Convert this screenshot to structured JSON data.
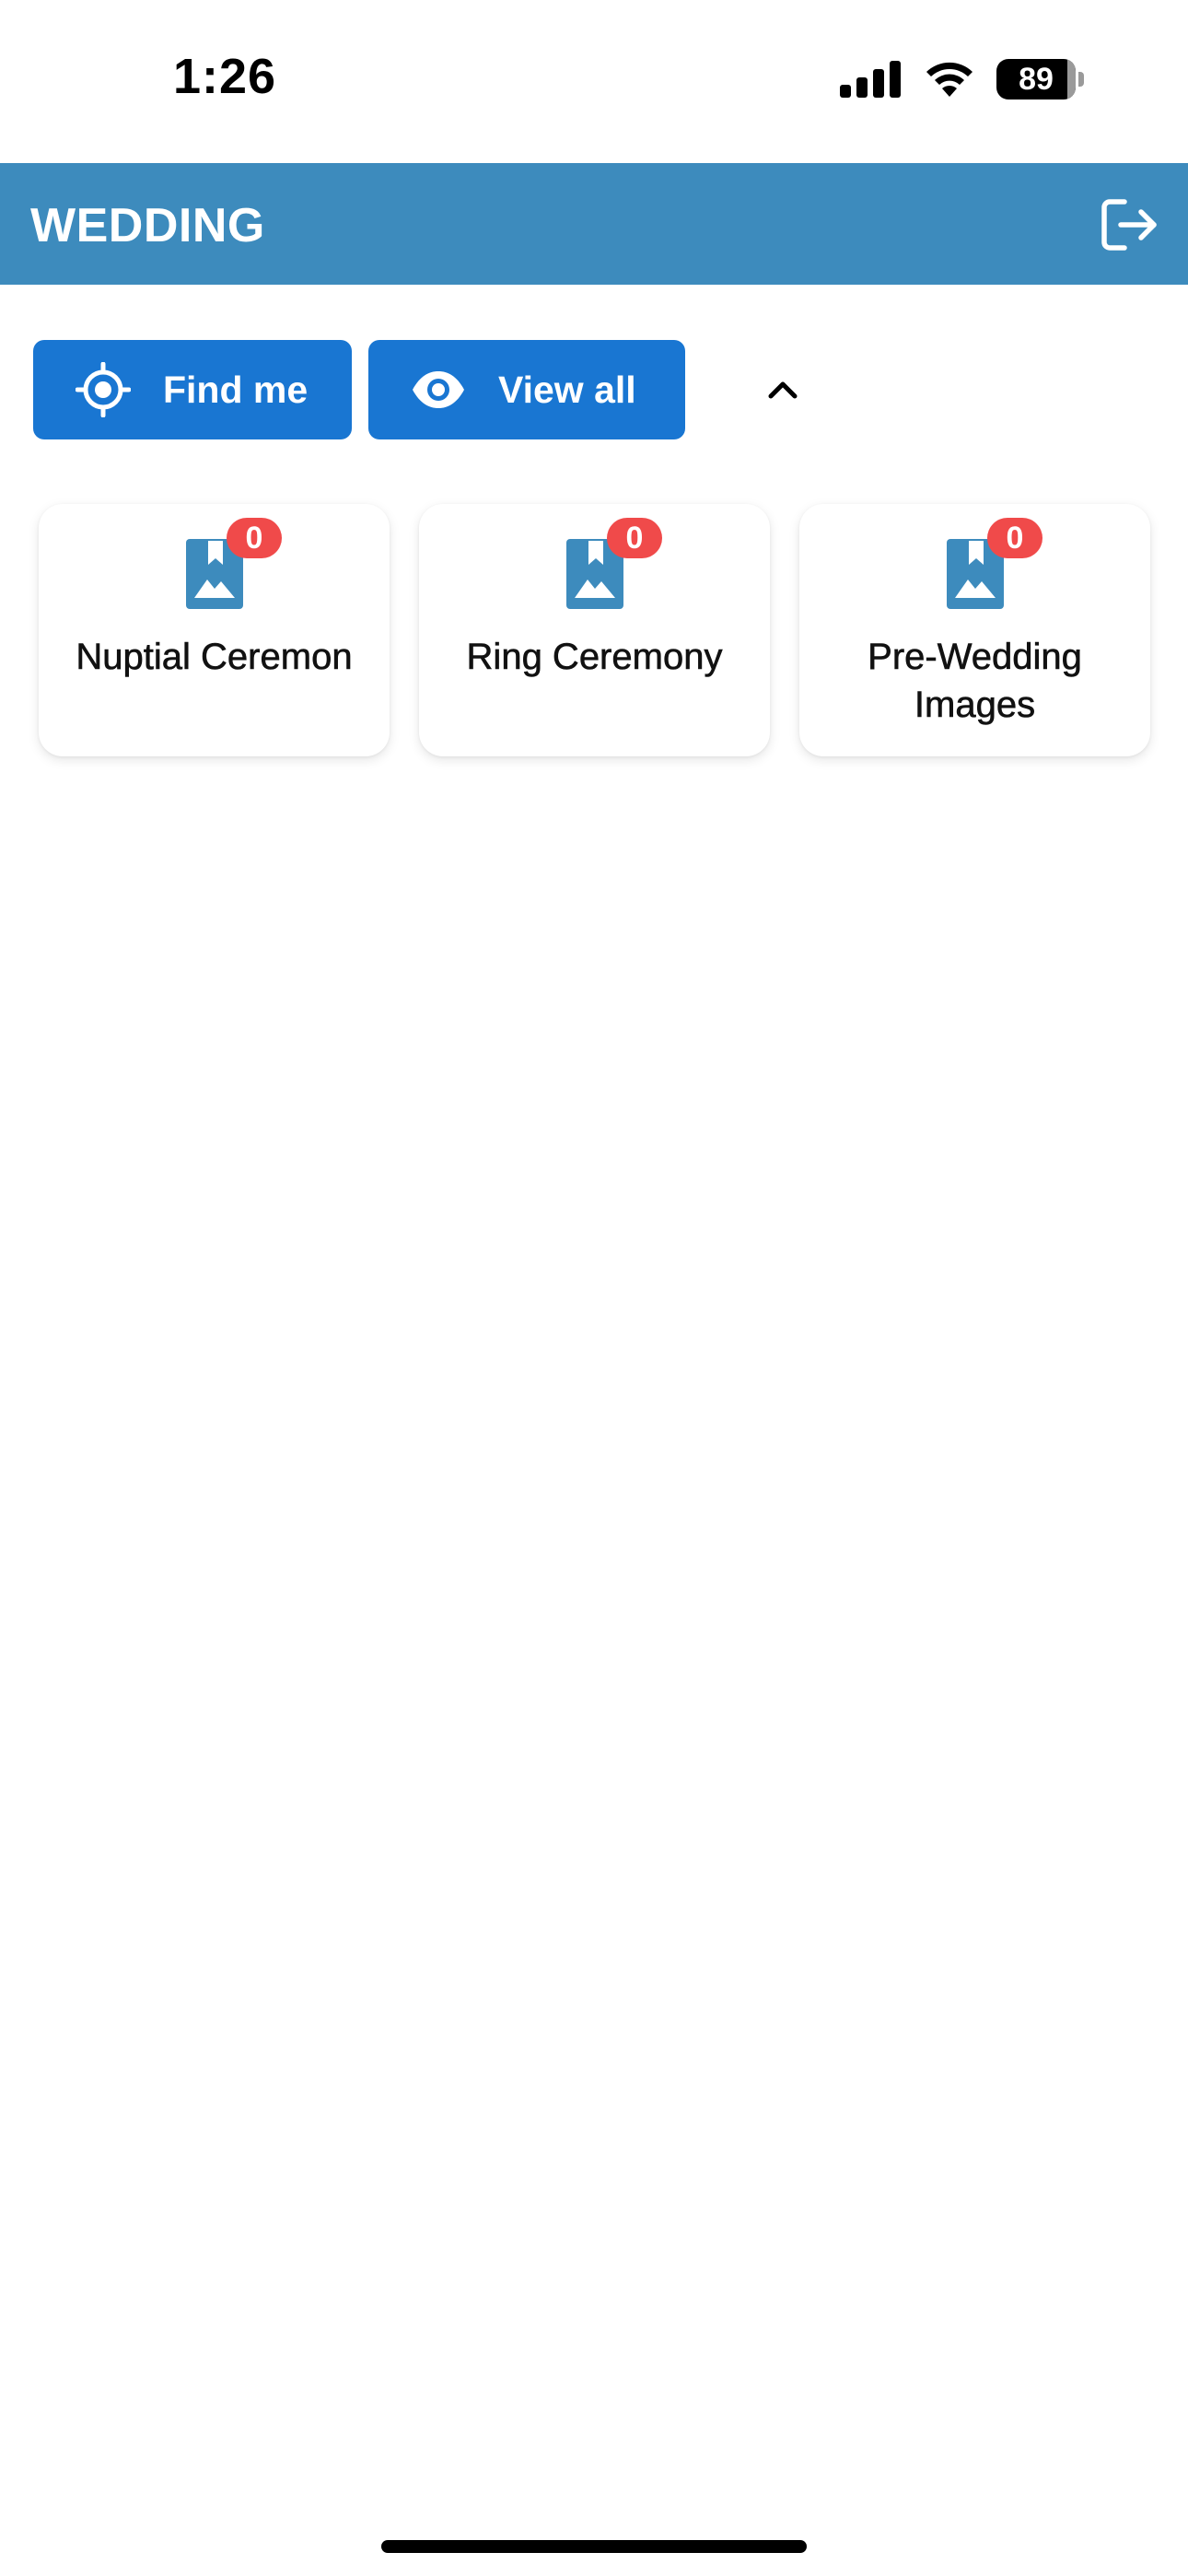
{
  "status_bar": {
    "time": "1:26",
    "battery_level": "89",
    "icons": [
      "signal-icon",
      "wifi-icon",
      "battery-icon"
    ]
  },
  "header": {
    "title": "WEDDING",
    "logout_icon": "logout-icon",
    "background_color": "#3d8bbd"
  },
  "actions": {
    "find_me": {
      "label": "Find me",
      "icon": "crosshair-icon"
    },
    "view_all": {
      "label": "View all",
      "icon": "eye-icon"
    },
    "collapse_icon": "chevron-up-icon",
    "button_color": "#1976d2"
  },
  "categories": [
    {
      "label": "Nuptial Ceremon",
      "count": "0",
      "icon": "photo-album-icon"
    },
    {
      "label": "Ring Ceremony",
      "count": "0",
      "icon": "photo-album-icon"
    },
    {
      "label": "Pre-Wedding Images",
      "count": "0",
      "icon": "photo-album-icon"
    }
  ],
  "colors": {
    "badge": "#f04a4a",
    "album_icon": "#3d8bbd"
  }
}
